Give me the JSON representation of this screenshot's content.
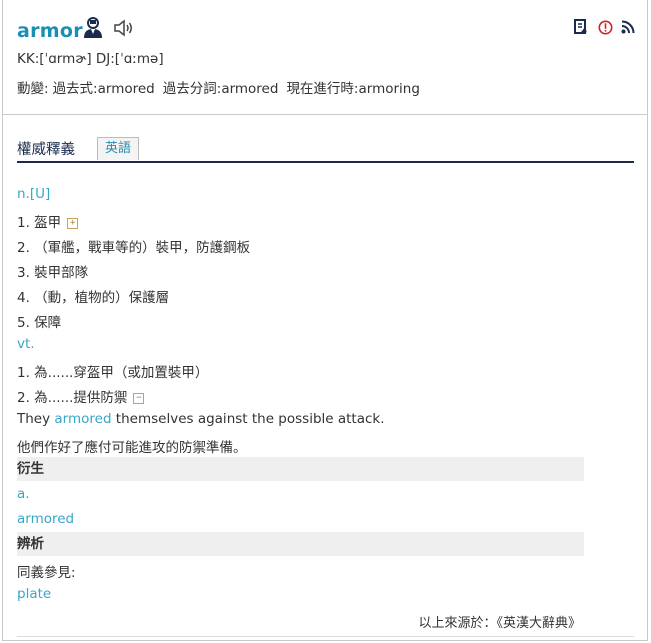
{
  "header": {
    "word": "armor",
    "pronunciation": "KK:[ˈɑrmɚ] DJ:[ˈɑːmə]",
    "forms_label": "動變:",
    "forms": [
      {
        "label": "過去式:",
        "value": "armored"
      },
      {
        "label": "過去分詞:",
        "value": "armored"
      },
      {
        "label": "現在進行時:",
        "value": "armoring"
      }
    ]
  },
  "tabs": {
    "main": "權威釋義",
    "english": "英語"
  },
  "entries": {
    "pos_noun": "n.[U]",
    "noun_senses": [
      "1. 盔甲",
      "2. （軍艦，戰車等的）裝甲，防護鋼板",
      "3. 裝甲部隊",
      "4. （動，植物的）保護層",
      "5. 保障"
    ],
    "pos_verb": "vt.",
    "verb_senses": [
      "1. 為......穿盔甲（或加置裝甲）",
      "2. 為......提供防禦"
    ],
    "example_before": "They ",
    "example_highlight": "armored",
    "example_after": " themselves against the possible attack.",
    "example_translation": "他們作好了應付可能進攻的防禦準備。",
    "derived_title": "衍生",
    "derived_pos": "a.",
    "derived_word": "armored",
    "analysis_title": "辨析",
    "synonym_label": "同義參見:",
    "synonym_word": "plate",
    "source": "以上來源於：《英漢大辭典》"
  },
  "colors": {
    "word": "#1a8fb3",
    "link": "#39a6c9",
    "tab_underline": "#1a2b4d",
    "section_bg": "#efefef"
  }
}
